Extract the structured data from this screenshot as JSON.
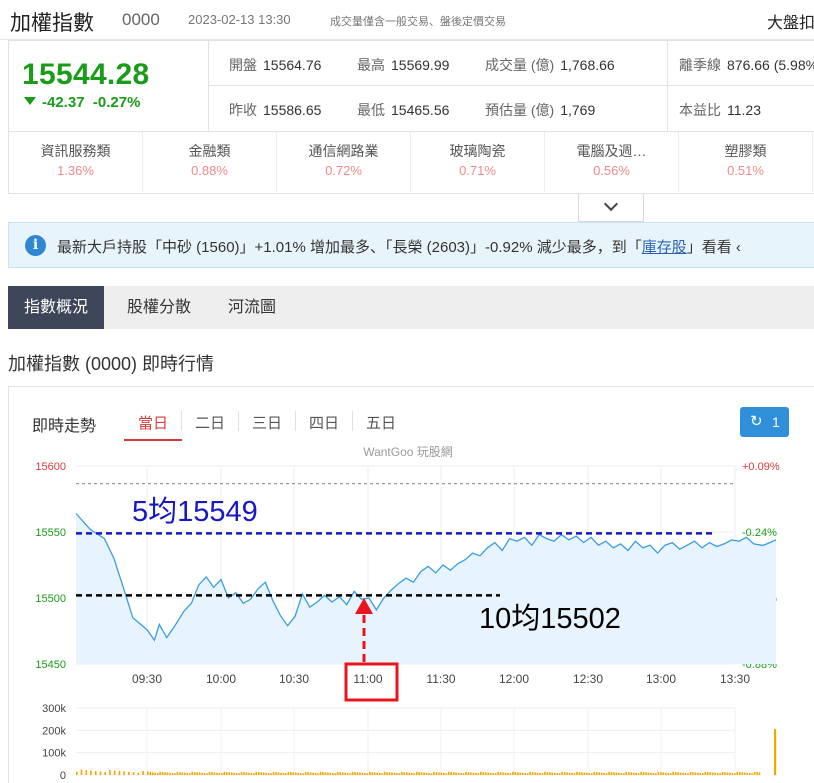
{
  "header": {
    "title": "加權指數",
    "code": "0000",
    "datetime": "2023-02-13 13:30",
    "note": "成交量僅含一般交易、盤後定價交易",
    "market_label": "大盤扣"
  },
  "quote": {
    "price": "15544.28",
    "change": "-42.37",
    "change_pct": "-0.27%",
    "row1": [
      {
        "label": "開盤",
        "value": "15564.76"
      },
      {
        "label": "最高",
        "value": "15569.99"
      },
      {
        "label": "成交量 (億)",
        "value": "1,768.66"
      },
      {
        "label": "離季線",
        "value": "876.66 (5.98%"
      }
    ],
    "row2": [
      {
        "label": "昨收",
        "value": "15586.65"
      },
      {
        "label": "最低",
        "value": "15465.56"
      },
      {
        "label": "預估量 (億)",
        "value": "1,769"
      },
      {
        "label": "本益比",
        "value": "11.23"
      }
    ]
  },
  "sectors": [
    {
      "name": "資訊服務類",
      "pct": "1.36%"
    },
    {
      "name": "金融類",
      "pct": "0.88%"
    },
    {
      "name": "通信網路業",
      "pct": "0.72%"
    },
    {
      "name": "玻璃陶瓷",
      "pct": "0.71%"
    },
    {
      "name": "電腦及週…",
      "pct": "0.56%"
    },
    {
      "name": "塑膠類",
      "pct": "0.51%"
    }
  ],
  "info_banner": {
    "text_before": "最新大戶持股「中砂 (1560)」+1.01% 增加最多、「長榮 (2603)」-0.92% 減少最多，到「",
    "link": "庫存股",
    "text_after": "」看看 ‹"
  },
  "tabs": [
    "指數概況",
    "股權分散",
    "河流圖"
  ],
  "section_title": "加權指數 (0000) 即時行情",
  "chart_panel": {
    "title": "即時走勢",
    "periods": [
      "當日",
      "二日",
      "三日",
      "四日",
      "五日"
    ],
    "refresh_label": "1",
    "watermark": "WantGoo 玩股網"
  },
  "colors": {
    "down_green": "#1a9c1a",
    "up_red": "#d63b3b",
    "accent_blue": "#2f8fd8",
    "line_blue": "#3a9de0",
    "area_fill": "#e8f4fd",
    "volume_orange": "#f0a800",
    "ma5_line": "#1717c8",
    "ma10_line": "#000000",
    "annotation_red": "#e8141e"
  },
  "chart_data": {
    "type": "line",
    "x_ticks": [
      "09:30",
      "10:00",
      "10:30",
      "11:00",
      "11:30",
      "12:00",
      "12:30",
      "13:00",
      "13:30"
    ],
    "y_ticks": [
      15600,
      15550,
      15500,
      15450
    ],
    "y_ticks_right": [
      "+0.09%",
      "-0.24%",
      "-0.56%",
      "-0.88%"
    ],
    "ylim": [
      15450,
      15600
    ],
    "prev_close": 15586.65,
    "series": [
      {
        "name": "",
        "x_minutes": [
          0,
          3,
          6,
          8,
          10,
          12,
          15,
          18,
          20,
          23,
          26,
          30,
          33,
          36,
          39,
          42,
          45,
          48,
          51,
          54,
          57,
          60,
          63,
          66,
          69,
          72,
          75,
          78,
          81,
          84,
          87,
          90,
          93,
          96,
          99,
          102,
          105,
          108,
          111,
          114,
          117,
          120,
          123,
          126,
          129,
          132,
          135,
          138,
          141,
          144,
          147,
          150,
          153,
          156,
          159,
          162,
          165,
          168,
          171,
          174,
          177,
          180,
          183,
          186,
          189,
          192,
          195,
          198,
          201,
          204,
          207,
          210,
          213,
          216,
          219,
          222,
          225,
          228,
          231,
          234,
          237,
          240,
          243,
          246,
          249,
          252,
          255,
          258,
          261,
          264,
          265,
          270
        ],
        "values": [
          15564,
          15552,
          15545,
          15530,
          15508,
          15485,
          15476,
          15468,
          15480,
          15470,
          15478,
          15490,
          15496,
          15510,
          15516,
          15508,
          15514,
          15500,
          15504,
          15496,
          15499,
          15507,
          15512,
          15498,
          15487,
          15479,
          15486,
          15503,
          15493,
          15497,
          15502,
          15497,
          15501,
          15495,
          15505,
          15499,
          15500,
          15491,
          15500,
          15506,
          15511,
          15515,
          15512,
          15520,
          15524,
          15519,
          15525,
          15521,
          15526,
          15529,
          15534,
          15532,
          15538,
          15542,
          15536,
          15545,
          15543,
          15546,
          15540,
          15548,
          15545,
          15543,
          15548,
          15544,
          15547,
          15542,
          15546,
          15540,
          15543,
          15538,
          15541,
          15536,
          15543,
          15538,
          15540,
          15534,
          15540,
          15542,
          15537,
          15540,
          15543,
          15538,
          15542,
          15539,
          15541,
          15544,
          15543,
          15546,
          15541,
          15540,
          15540,
          15544
        ]
      }
    ],
    "reference_lines": [
      {
        "label": "5均15549",
        "value": 15549
      },
      {
        "label": "10均15502",
        "value": 15502
      }
    ],
    "annotation_time": "11:00",
    "volume": {
      "y_ticks": [
        "300k",
        "200k",
        "100k",
        "0"
      ],
      "ylim": [
        0,
        300000
      ],
      "typical": 20000,
      "last": 205000
    }
  }
}
